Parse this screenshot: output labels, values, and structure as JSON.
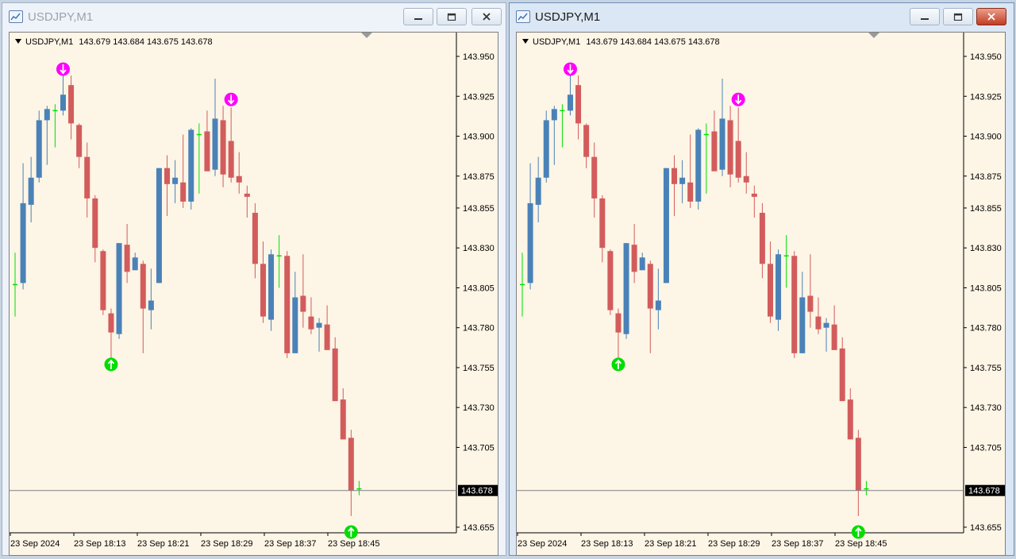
{
  "windows": [
    {
      "id": "left",
      "title": "USDJPY,M1",
      "active": false,
      "controls": {
        "minimize": "minimize",
        "maximize": "maximize",
        "close": "close"
      },
      "chart_header": {
        "symbol": "USDJPY,M1",
        "open": "143.679",
        "high": "143.684",
        "low": "143.675",
        "close": "143.678"
      }
    },
    {
      "id": "right",
      "title": "USDJPY,M1",
      "active": true,
      "controls": {
        "minimize": "minimize",
        "maximize": "maximize",
        "close": "close"
      },
      "chart_header": {
        "symbol": "USDJPY,M1",
        "open": "143.679",
        "high": "143.684",
        "low": "143.675",
        "close": "143.678"
      }
    }
  ],
  "colors": {
    "bull": "#4a82b8",
    "bear": "#d25c5c",
    "neutral": "#00e000",
    "sell_arrow": "#ff00ff",
    "buy_arrow": "#00dd00",
    "background": "#fdf5e6",
    "price_line": "#808080"
  },
  "icons": {
    "sell_signal": "down-arrow-circle-icon",
    "buy_signal": "up-arrow-circle-icon",
    "shift_marker": "triangle-marker-icon"
  },
  "chart_data": {
    "type": "candlestick",
    "symbol": "USDJPY",
    "timeframe": "M1",
    "ylim": [
      143.645,
      143.96
    ],
    "yticks": [
      "143.950",
      "143.925",
      "143.900",
      "143.875",
      "143.855",
      "143.830",
      "143.805",
      "143.780",
      "143.755",
      "143.730",
      "143.705",
      "143.678",
      "143.655"
    ],
    "xticks": [
      "23 Sep 2024",
      "23 Sep 18:13",
      "23 Sep 18:21",
      "23 Sep 18:29",
      "23 Sep 18:37",
      "23 Sep 18:45"
    ],
    "current_price": "143.678",
    "candles": [
      {
        "o": 143.807,
        "h": 143.827,
        "l": 143.787,
        "c": 143.806
      },
      {
        "o": 143.808,
        "h": 143.883,
        "l": 143.804,
        "c": 143.858
      },
      {
        "o": 143.857,
        "h": 143.887,
        "l": 143.846,
        "c": 143.874
      },
      {
        "o": 143.874,
        "h": 143.916,
        "l": 143.871,
        "c": 143.91
      },
      {
        "o": 143.91,
        "h": 143.919,
        "l": 143.882,
        "c": 143.917
      },
      {
        "o": 143.915,
        "h": 143.92,
        "l": 143.893,
        "c": 143.916
      },
      {
        "o": 143.916,
        "h": 143.945,
        "l": 143.913,
        "c": 143.926
      },
      {
        "o": 143.932,
        "h": 143.938,
        "l": 143.898,
        "c": 143.908
      },
      {
        "o": 143.907,
        "h": 143.908,
        "l": 143.88,
        "c": 143.887
      },
      {
        "o": 143.887,
        "h": 143.896,
        "l": 143.849,
        "c": 143.861
      },
      {
        "o": 143.861,
        "h": 143.863,
        "l": 143.821,
        "c": 143.83
      },
      {
        "o": 143.828,
        "h": 143.829,
        "l": 143.788,
        "c": 143.791
      },
      {
        "o": 143.789,
        "h": 143.792,
        "l": 143.759,
        "c": 143.777
      },
      {
        "o": 143.776,
        "h": 143.833,
        "l": 143.773,
        "c": 143.833
      },
      {
        "o": 143.832,
        "h": 143.845,
        "l": 143.808,
        "c": 143.815
      },
      {
        "o": 143.816,
        "h": 143.827,
        "l": 143.817,
        "c": 143.824
      },
      {
        "o": 143.82,
        "h": 143.822,
        "l": 143.764,
        "c": 143.792
      },
      {
        "o": 143.791,
        "h": 143.817,
        "l": 143.779,
        "c": 143.797
      },
      {
        "o": 143.808,
        "h": 143.88,
        "l": 143.808,
        "c": 143.88
      },
      {
        "o": 143.88,
        "h": 143.888,
        "l": 143.85,
        "c": 143.87
      },
      {
        "o": 143.87,
        "h": 143.885,
        "l": 143.858,
        "c": 143.874
      },
      {
        "o": 143.871,
        "h": 143.901,
        "l": 143.855,
        "c": 143.859
      },
      {
        "o": 143.859,
        "h": 143.905,
        "l": 143.854,
        "c": 143.904
      },
      {
        "o": 143.901,
        "h": 143.908,
        "l": 143.864,
        "c": 143.901
      },
      {
        "o": 143.903,
        "h": 143.916,
        "l": 143.882,
        "c": 143.878
      },
      {
        "o": 143.879,
        "h": 143.936,
        "l": 143.875,
        "c": 143.911
      },
      {
        "o": 143.91,
        "h": 143.919,
        "l": 143.868,
        "c": 143.876
      },
      {
        "o": 143.897,
        "h": 143.918,
        "l": 143.871,
        "c": 143.874
      },
      {
        "o": 143.875,
        "h": 143.89,
        "l": 143.864,
        "c": 143.871
      },
      {
        "o": 143.864,
        "h": 143.869,
        "l": 143.849,
        "c": 143.862
      },
      {
        "o": 143.852,
        "h": 143.858,
        "l": 143.811,
        "c": 143.82
      },
      {
        "o": 143.82,
        "h": 143.834,
        "l": 143.783,
        "c": 143.787
      },
      {
        "o": 143.785,
        "h": 143.829,
        "l": 143.778,
        "c": 143.826
      },
      {
        "o": 143.825,
        "h": 143.838,
        "l": 143.805,
        "c": 143.825
      },
      {
        "o": 143.825,
        "h": 143.828,
        "l": 143.761,
        "c": 143.764
      },
      {
        "o": 143.764,
        "h": 143.815,
        "l": 143.764,
        "c": 143.799
      },
      {
        "o": 143.8,
        "h": 143.826,
        "l": 143.78,
        "c": 143.79
      },
      {
        "o": 143.787,
        "h": 143.799,
        "l": 143.776,
        "c": 143.779
      },
      {
        "o": 143.78,
        "h": 143.786,
        "l": 143.765,
        "c": 143.783
      },
      {
        "o": 143.782,
        "h": 143.794,
        "l": 143.768,
        "c": 143.766
      },
      {
        "o": 143.767,
        "h": 143.774,
        "l": 143.735,
        "c": 143.734
      },
      {
        "o": 143.735,
        "h": 143.742,
        "l": 143.71,
        "c": 143.71
      },
      {
        "o": 143.711,
        "h": 143.716,
        "l": 143.662,
        "c": 143.678
      },
      {
        "o": 143.679,
        "h": 143.684,
        "l": 143.675,
        "c": 143.678
      }
    ],
    "signals": [
      {
        "type": "sell",
        "index": 6,
        "price": 143.942
      },
      {
        "type": "sell",
        "index": 27,
        "price": 143.923
      },
      {
        "type": "buy",
        "index": 12,
        "price": 143.757
      },
      {
        "type": "buy",
        "index": 42,
        "price": 143.652
      }
    ]
  }
}
